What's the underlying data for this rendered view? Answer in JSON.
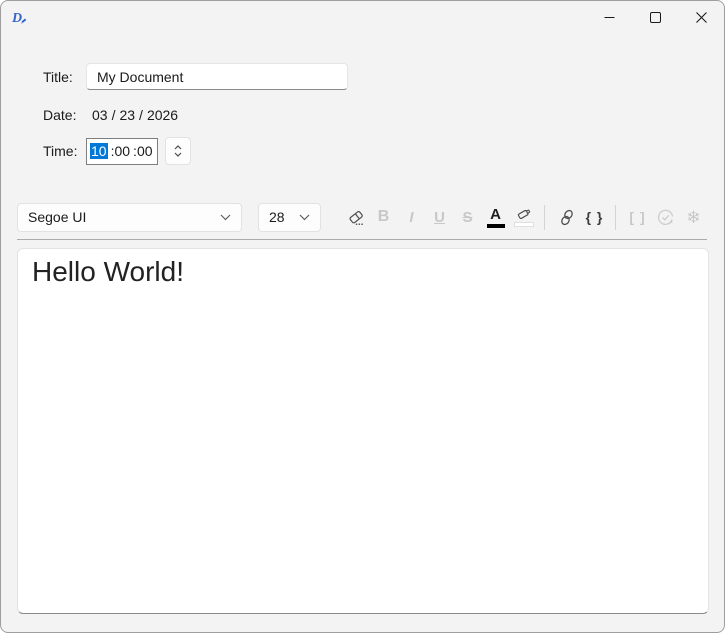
{
  "window": {
    "app_icon": "document-pen-icon",
    "controls": {
      "minimize_icon": "minimize-icon",
      "maximize_icon": "maximize-icon",
      "close_icon": "close-icon"
    }
  },
  "form": {
    "title": {
      "label": "Title:",
      "value": "My Document"
    },
    "date": {
      "label": "Date:",
      "month": "03",
      "day": "23",
      "year": "2026",
      "separator": "/"
    },
    "time": {
      "label": "Time:",
      "hour": "10",
      "minute": "00",
      "second": "00",
      "colon": ":",
      "spinner_icon": "up-down-chevrons-icon"
    }
  },
  "toolbar": {
    "font_family": {
      "value": "Segoe UI",
      "chevron": "chevron-down-icon"
    },
    "font_size": {
      "value": "28",
      "chevron": "chevron-down-icon"
    },
    "clear_format": {
      "icon": "eraser-icon",
      "enabled": true
    },
    "bold": {
      "glyph": "B",
      "enabled": false
    },
    "italic": {
      "glyph": "I",
      "enabled": false
    },
    "underline": {
      "glyph": "U",
      "enabled": false
    },
    "strikethrough": {
      "glyph": "S",
      "enabled": false
    },
    "font_color": {
      "glyph": "A",
      "swatch": "#000000",
      "enabled": true
    },
    "highlight": {
      "icon": "highlighter-icon",
      "swatch": "#ffffff",
      "enabled": true
    },
    "link": {
      "icon": "link-icon",
      "enabled": true
    },
    "code": {
      "glyph": "{ }",
      "enabled": true
    },
    "brackets": {
      "glyph": "[ ]",
      "enabled": false
    },
    "sync_check": {
      "icon": "check-circle-arrow-icon",
      "enabled": false
    },
    "freeze": {
      "glyph": "❄",
      "icon": "snowflake-icon",
      "enabled": false
    }
  },
  "editor": {
    "content": "Hello World!"
  },
  "colors": {
    "accent": "#0078d7",
    "window_background": "#f3f3f3",
    "icon_blue": "#3565c9",
    "font_color_swatch": "#000000",
    "highlight_swatch": "#ffffff"
  }
}
